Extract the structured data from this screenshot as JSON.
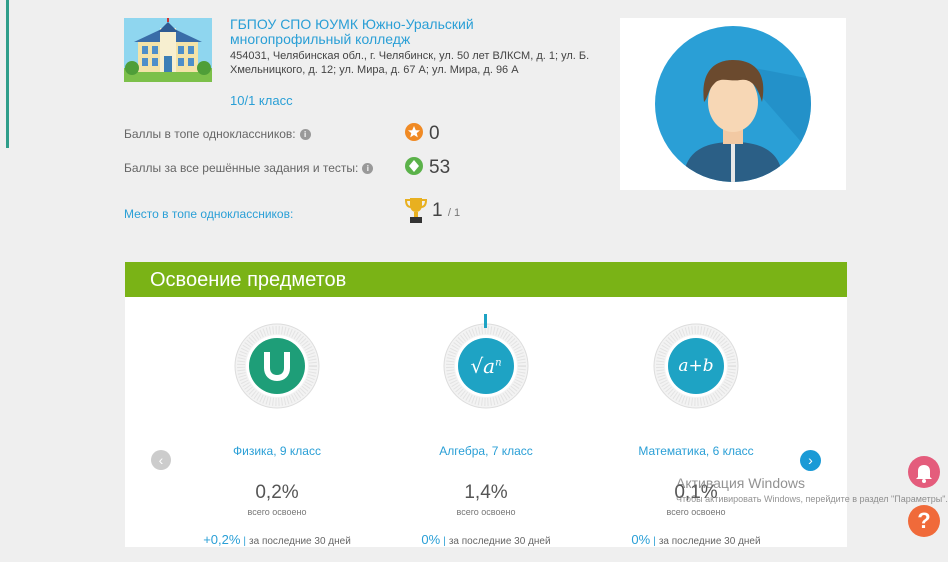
{
  "school": {
    "name": "ГБПОУ СПО ЮУМК Южно-Уральский многопрофильный колледж",
    "address": "454031, Челябинская обл., г. Челябинск, ул. 50 лет ВЛКСМ, д. 1; ул. Б. Хмельницкого, д. 12; ул. Мира, д. 67 А; ул. Мира, д. 96 А",
    "class_link": "10/1 класс"
  },
  "stats": {
    "top_points_label": "Баллы в топе одноклассников:",
    "top_points_value": "0",
    "all_points_label": "Баллы за все решённые задания и тесты:",
    "all_points_value": "53",
    "place_label": "Место в топе одноклассников:",
    "place_value": "1",
    "place_total": "/ 1"
  },
  "subjects_panel": {
    "title": "Освоение предметов",
    "items": [
      {
        "name": "Физика, 9 класс",
        "percent": "0,2%",
        "percent_caption": "всего освоено",
        "delta": "+0,2%",
        "delta_caption": "за последние 30 дней",
        "icon": "magnet-icon",
        "color": "#1e9e78"
      },
      {
        "name": "Алгебра, 7 класс",
        "percent": "1,4%",
        "percent_caption": "всего освоено",
        "delta": "0%",
        "delta_caption": "за последние 30 дней",
        "icon": "sqrt-icon",
        "icon_text": "√a",
        "icon_sup": "n",
        "color": "#1ea3c4"
      },
      {
        "name": "Математика, 6 класс",
        "percent": "0,1%",
        "percent_caption": "всего освоено",
        "delta": "0%",
        "delta_caption": "за последние 30 дней",
        "icon": "a-plus-b-icon",
        "icon_text": "a+b",
        "color": "#1ea3c4"
      }
    ],
    "prev_glyph": "‹",
    "next_glyph": "›"
  },
  "watermark": {
    "line1": "Активация Windows",
    "line2": "Чтобы активировать Windows, перейдите в раздел \"Параметры\"."
  },
  "floating": {
    "help_glyph": "?"
  },
  "colors": {
    "accent_blue": "#2a9fd6",
    "panel_green": "#7ab316",
    "bell_pink": "#e45c7c",
    "help_orange": "#f06a3a"
  }
}
